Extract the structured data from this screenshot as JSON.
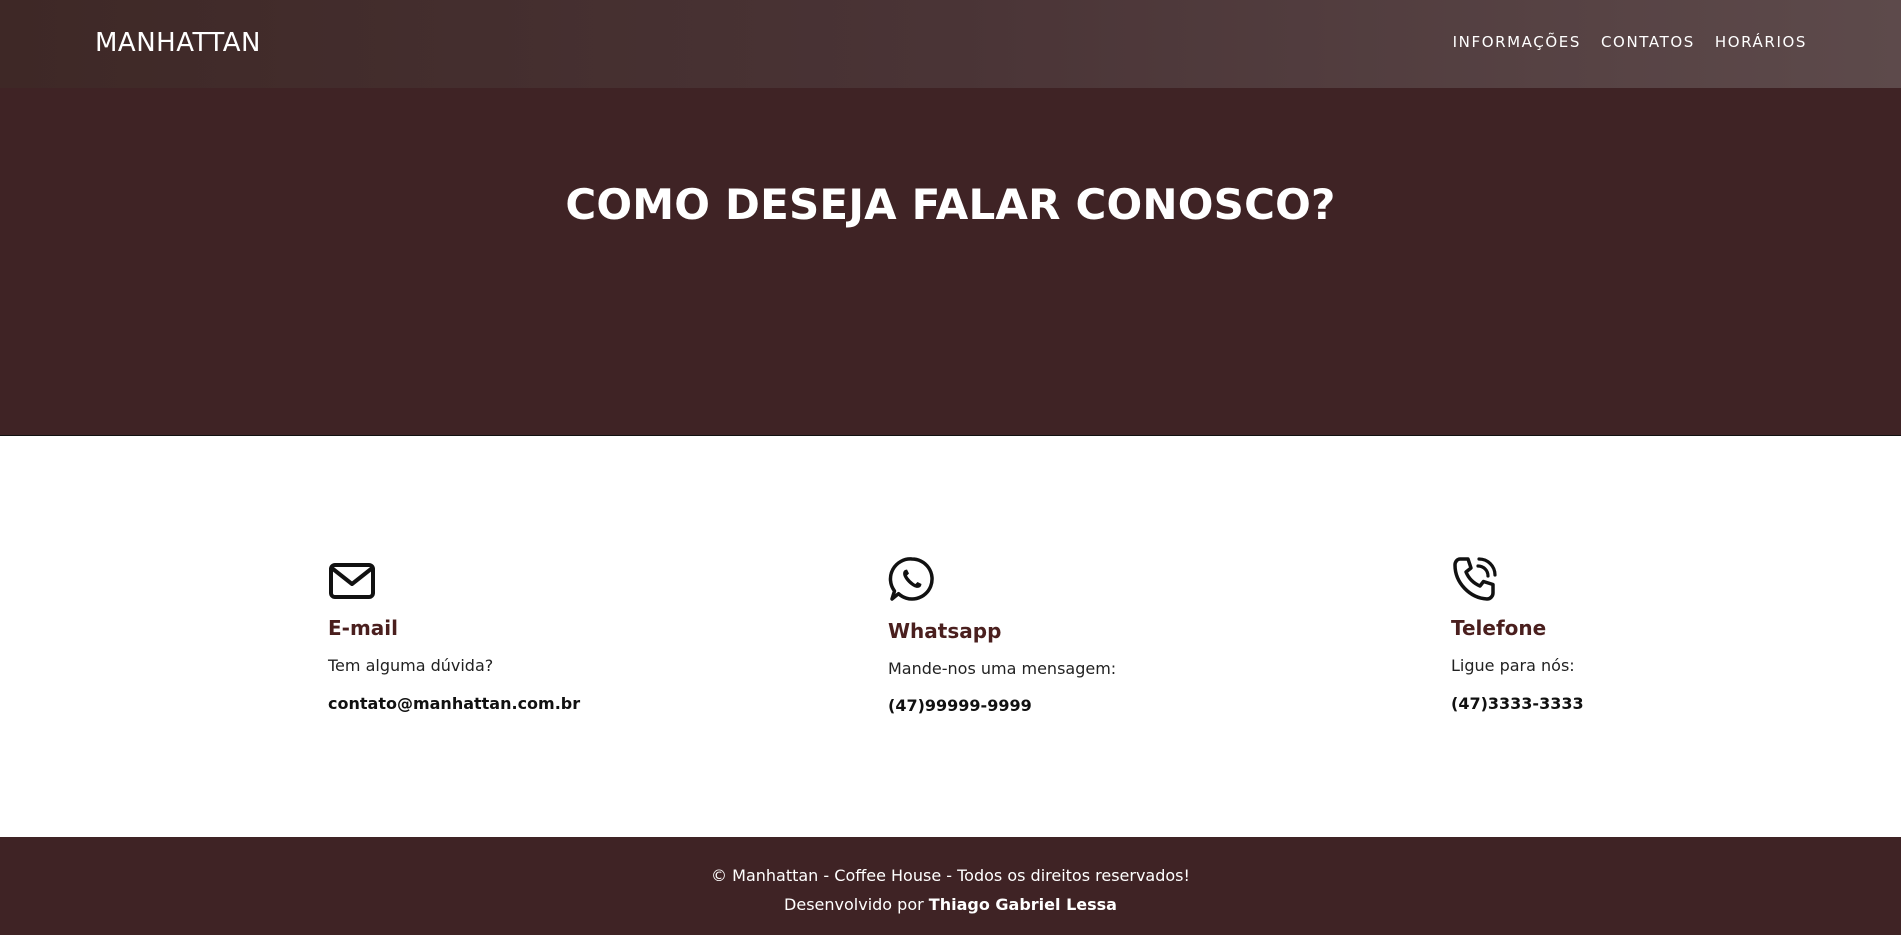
{
  "header": {
    "brand": "MANHATTAN",
    "nav": [
      {
        "label": "INFORMAÇÕES"
      },
      {
        "label": "CONTATOS"
      },
      {
        "label": "HORÁRIOS"
      }
    ]
  },
  "hero": {
    "title": "COMO DESEJA FALAR CONOSCO?"
  },
  "contacts": [
    {
      "icon": "envelope-icon",
      "title": "E-mail",
      "subtitle": "Tem alguma dúvida?",
      "value": "contato@manhattan.com.br"
    },
    {
      "icon": "whatsapp-icon",
      "title": "Whatsapp",
      "subtitle": "Mande-nos uma mensagem:",
      "value": "(47)99999-9999"
    },
    {
      "icon": "phone-icon",
      "title": "Telefone",
      "subtitle": "Ligue para nós:",
      "value": "(47)3333-3333"
    }
  ],
  "footer": {
    "copyright": "© Manhattan - Coffee House - Todos os direitos reservados!",
    "dev_prefix": "Desenvolvido por",
    "dev_name": "Thiago Gabriel Lessa"
  },
  "colors": {
    "header_bg": "#4a3436",
    "hero_bg": "#3f2325",
    "footer_bg": "#3f2325",
    "accent_title": "#4a1f1e",
    "text_light": "#ffffff"
  }
}
